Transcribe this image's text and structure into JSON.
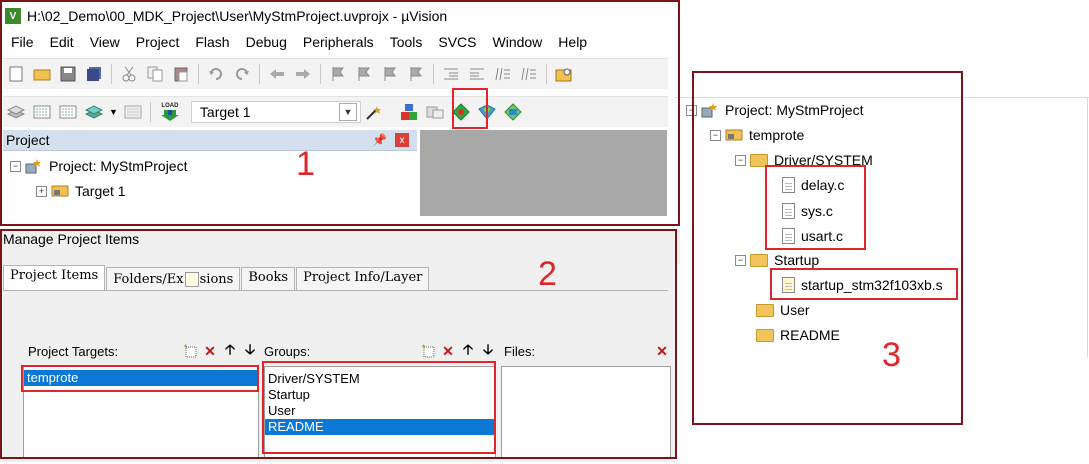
{
  "window": {
    "title": "H:\\02_Demo\\00_MDK_Project\\User\\MyStmProject.uvprojx - µVision",
    "logo_text": "V"
  },
  "menu": [
    "File",
    "Edit",
    "View",
    "Project",
    "Flash",
    "Debug",
    "Peripherals",
    "Tools",
    "SVCS",
    "Window",
    "Help"
  ],
  "toolbar2": {
    "load_label": "LOAD",
    "target": "Target 1"
  },
  "project_panel": {
    "title": "Project",
    "pin": "\t",
    "close": "x",
    "tree": [
      "Project: MyStmProject",
      "Target 1"
    ]
  },
  "manage": {
    "title": "Manage Project Items",
    "tabs": [
      "Project Items",
      "Folders/Ex",
      "sions",
      "Books",
      "Project Info/Layer"
    ],
    "targets_label": "Project Targets:",
    "targets": [
      "temprote"
    ],
    "groups_label": "Groups:",
    "groups": [
      "Driver/SYSTEM",
      "Startup",
      "User",
      "README"
    ],
    "files_label": "Files:"
  },
  "right_tree": {
    "project": "Project: MyStmProject",
    "target": "temprote",
    "group1": "Driver/SYSTEM",
    "files1": [
      "delay.c",
      "sys.c",
      "usart.c"
    ],
    "group2": "Startup",
    "files2": [
      "startup_stm32f103xb.s"
    ],
    "group3": "User",
    "group4": "README"
  },
  "annotations": {
    "n1": "1",
    "n2": "2",
    "n3": "3"
  },
  "colors": {
    "annotation_red": "#e0262a",
    "annotation_dark": "#7a1418",
    "selection": "#0a78d4"
  }
}
